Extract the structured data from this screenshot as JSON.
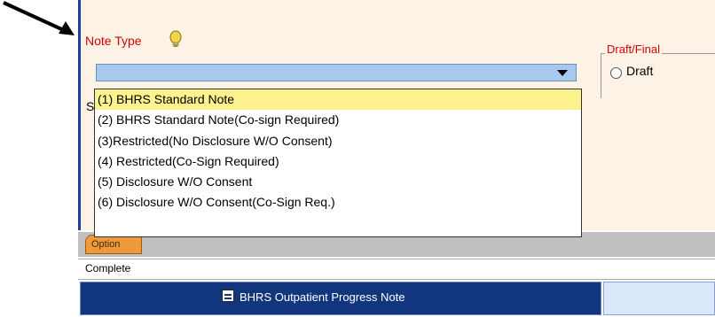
{
  "form": {
    "note_type_label": "Note Type",
    "dropdown_value": "",
    "s_letter": "S"
  },
  "draft_final": {
    "legend": "Draft/Final",
    "option_label": "Draft"
  },
  "list": {
    "items": [
      "(1) BHRS Standard Note",
      "(2) BHRS Standard Note(Co-sign Required)",
      "(3)Restricted(No Disclosure W/O Consent)",
      "(4) Restricted(Co-Sign Required)",
      "(5) Disclosure W/O Consent",
      "(6) Disclosure W/O Consent(Co-Sign Req.)"
    ],
    "selected_index": 0
  },
  "footer": {
    "option_tab": "Option",
    "complete_text": "Complete",
    "bottom_tab_label": "BHRS Outpatient Progress Note"
  },
  "colors": {
    "panel_bg": "#fcf3e6",
    "label_red": "#d40000",
    "dropdown_bg": "#a9c8f0",
    "selected_item": "#fdf28e",
    "tab_orange": "#ef9a3a",
    "bottom_tab_blue": "#12367e"
  },
  "icons": {
    "bulb": "lightbulb-icon",
    "dropdown_arrow": "chevron-down-icon",
    "grid": "form-grid-icon",
    "pointer": "arrow-pointer"
  }
}
